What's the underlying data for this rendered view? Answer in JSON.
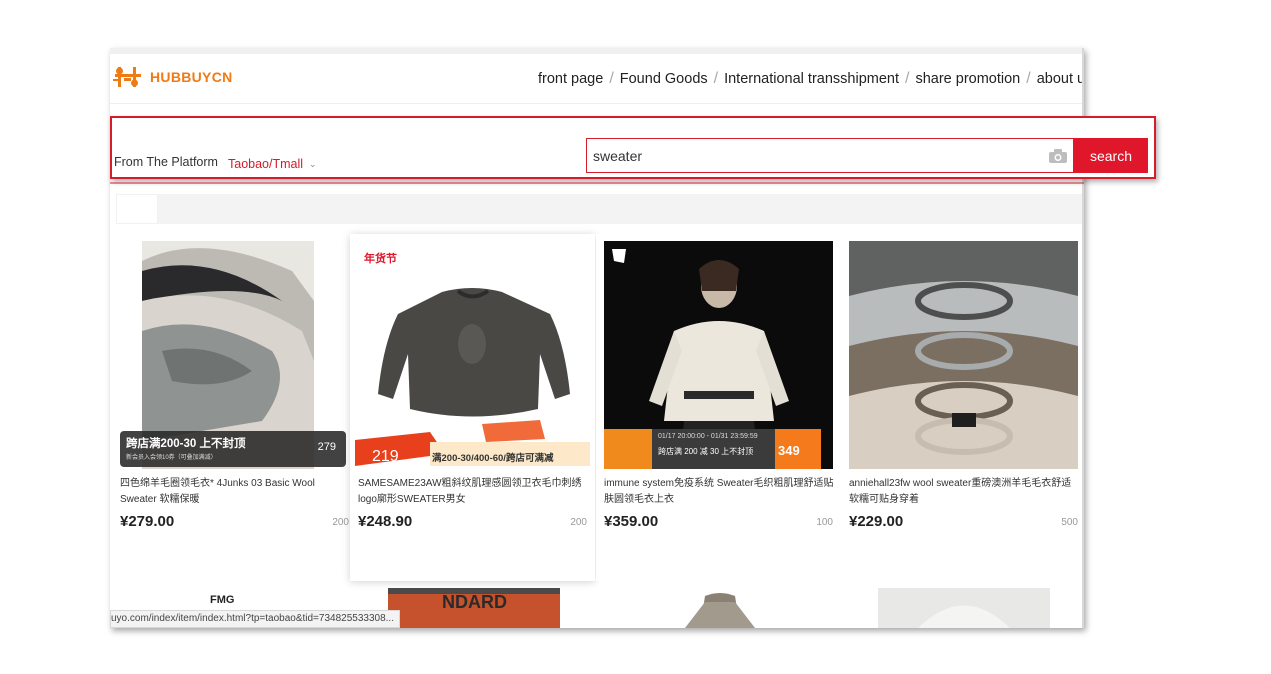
{
  "logo": {
    "text": "HUBBUYCN"
  },
  "nav": {
    "items": [
      "front page",
      "Found Goods",
      "International transshipment",
      "share promotion",
      "about us"
    ],
    "separator": "/"
  },
  "search": {
    "platform_label": "From The Platform",
    "platform_value": "Taobao/Tmall",
    "query": "sweater",
    "button_label": "search"
  },
  "products": [
    {
      "title": "四色绵羊毛圈领毛衣* 4Junks 03 Basic Wool Sweater 软糯保暖",
      "price": "¥279.00",
      "sold": "200",
      "badge_text": "跨店满200-30 上不封顶",
      "badge_sub": "新会员入会领10券（可叠加满减）",
      "badge_price": "279"
    },
    {
      "title": "SAMESAME23AW粗斜纹肌理感圆领卫衣毛巾刺绣logo廓形SWEATER男女",
      "price": "¥248.90",
      "sold": "200",
      "festival_label": "年货节",
      "banner_price": "219",
      "banner_text": "满200-30/400-60/跨店可满减"
    },
    {
      "title": "immune system免疫系统 Sweater毛织粗肌理舒适贴肤圆领毛衣上衣",
      "price": "¥359.00",
      "sold": "100",
      "banner_dates": "01/17 20:00:00 - 01/31 23:59:59",
      "banner_text": "跨店满 200 减 30 上不封顶",
      "banner_price": "349"
    },
    {
      "title": "anniehall23fw wool sweater重磅澳洲羊毛毛衣舒适软糯可贴身穿着",
      "price": "¥229.00",
      "sold": "500"
    }
  ],
  "second_row": {
    "brand_text": "FMG",
    "sign_text": "NDARD"
  },
  "status_bar": {
    "url": "uyo.com/index/item/index.html?tp=taobao&tid=734825533308..."
  },
  "colors": {
    "accent": "#e0162b",
    "logo": "#f07a14"
  }
}
